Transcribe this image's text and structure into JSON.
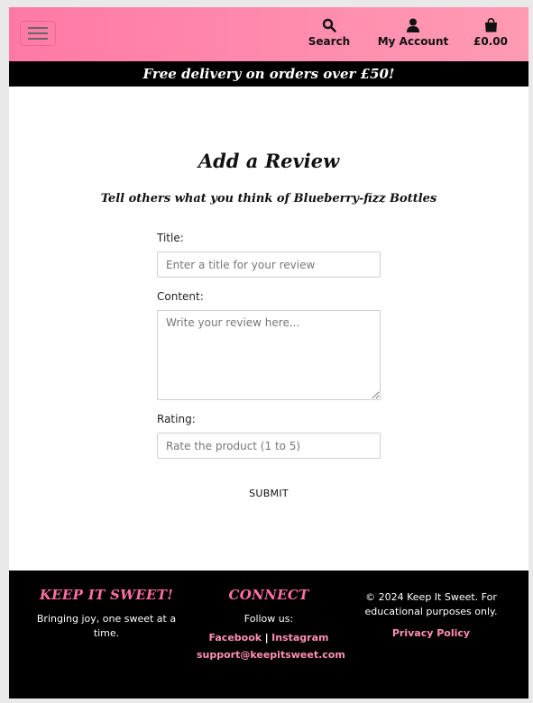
{
  "header": {
    "search_label": "Search",
    "account_label": "My Account",
    "bag_total": "£0.00",
    "icons": {
      "menu": "hamburger-icon",
      "search": "magnifier-icon",
      "account": "user-icon",
      "bag": "shopping-bag-icon"
    },
    "gradient_colors": [
      "#ff79a6",
      "#ff9bb3"
    ]
  },
  "promo": {
    "text": "Free delivery on orders over £50!"
  },
  "review_form": {
    "heading": "Add a Review",
    "subheading": "Tell others what you think of Blueberry-fizz Bottles",
    "title_label": "Title:",
    "title_placeholder": "Enter a title for your review",
    "content_label": "Content:",
    "content_placeholder": "Write your review here...",
    "rating_label": "Rating:",
    "rating_placeholder": "Rate the product (1 to 5)",
    "submit_label": "SUBMIT"
  },
  "footer": {
    "brand_heading": "KEEP IT SWEET!",
    "brand_tagline": "Bringing joy, one sweet at a time.",
    "connect_heading": "CONNECT",
    "follow_text": "Follow us:",
    "facebook_label": "Facebook",
    "separator": "|",
    "instagram_label": "Instagram",
    "email": "support@keepitsweet.com",
    "copyright": "© 2024 Keep It Sweet. For educational purposes only.",
    "privacy_label": "Privacy Policy",
    "accent_color": "#ff6fa3"
  }
}
